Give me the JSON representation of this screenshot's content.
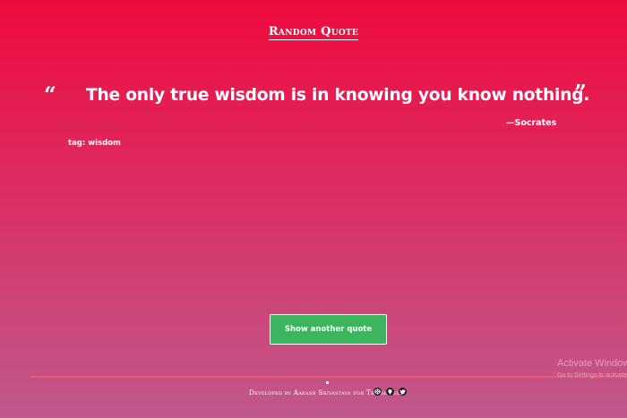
{
  "header": {
    "title": "Random Quote"
  },
  "quote": {
    "open_mark": "“",
    "text": "The only true wisdom is in knowing you know nothing.",
    "close_mark": "”",
    "author": "—Socrates",
    "tag": "tag: wisdom"
  },
  "actions": {
    "show_another_label": "Show another quote"
  },
  "footer": {
    "credit": "Developed by Aakash Srivastava for Treehouse",
    "icons": [
      "codepen-icon",
      "github-icon",
      "twitter-icon"
    ]
  },
  "os_overlay": {
    "title": "Activate Windows",
    "subtitle": "Go to Settings to activate Windows."
  },
  "colors": {
    "gradient_top": "#ef0a3e",
    "gradient_bottom": "#c0598c",
    "button_green": "#3cb55e",
    "footer_line": "#f0566e"
  }
}
